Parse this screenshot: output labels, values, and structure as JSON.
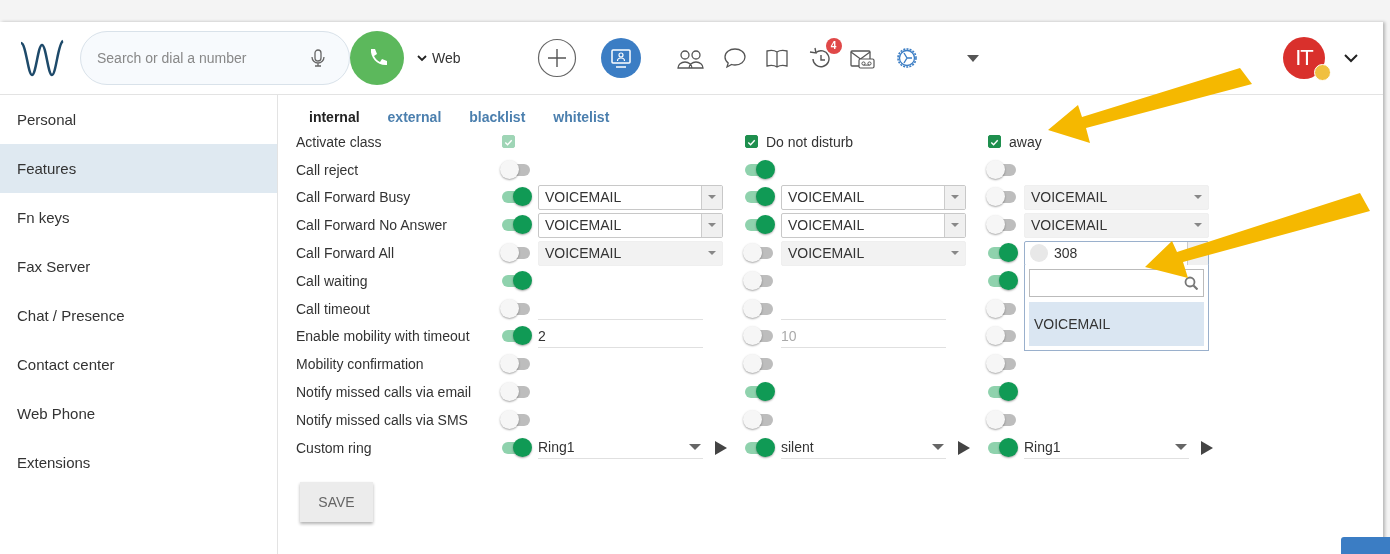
{
  "header": {
    "search": {
      "placeholder": "Search or dial a number"
    },
    "line_selector": "Web",
    "history_badge": "4",
    "avatar": {
      "initials": "IT"
    }
  },
  "sidebar": {
    "items": [
      {
        "label": "Personal",
        "selected": false
      },
      {
        "label": "Features",
        "selected": true
      },
      {
        "label": "Fn keys",
        "selected": false
      },
      {
        "label": "Fax Server",
        "selected": false
      },
      {
        "label": "Chat / Presence",
        "selected": false
      },
      {
        "label": "Contact center",
        "selected": false
      },
      {
        "label": "Web Phone",
        "selected": false
      },
      {
        "label": "Extensions",
        "selected": false
      }
    ]
  },
  "tabs": [
    {
      "label": "internal",
      "selected": true
    },
    {
      "label": "external",
      "selected": false
    },
    {
      "label": "blacklist",
      "selected": false
    },
    {
      "label": "whitelist",
      "selected": false
    }
  ],
  "rows": [
    {
      "label": "Activate class",
      "cells": [
        {
          "kind": "check",
          "checked": true,
          "disabled": true
        },
        {
          "kind": "check",
          "checked": true,
          "disabled": false,
          "label": "Do not disturb"
        },
        {
          "kind": "check",
          "checked": true,
          "disabled": false,
          "label": "away"
        }
      ]
    },
    {
      "label": "Call reject",
      "cells": [
        {
          "kind": "toggle",
          "on": false
        },
        {
          "kind": "toggle",
          "on": true
        },
        {
          "kind": "toggle",
          "on": false
        }
      ]
    },
    {
      "label": "Call Forward Busy",
      "cells": [
        {
          "kind": "toggle",
          "on": true,
          "field": {
            "kind": "select",
            "value": "VOICEMAIL",
            "disabled": false
          }
        },
        {
          "kind": "toggle",
          "on": true,
          "field": {
            "kind": "select",
            "value": "VOICEMAIL",
            "disabled": false
          }
        },
        {
          "kind": "toggle",
          "on": false,
          "field": {
            "kind": "select",
            "value": "VOICEMAIL",
            "disabled": true
          }
        }
      ]
    },
    {
      "label": "Call Forward No Answer",
      "cells": [
        {
          "kind": "toggle",
          "on": true,
          "field": {
            "kind": "select",
            "value": "VOICEMAIL",
            "disabled": false
          }
        },
        {
          "kind": "toggle",
          "on": true,
          "field": {
            "kind": "select",
            "value": "VOICEMAIL",
            "disabled": false
          }
        },
        {
          "kind": "toggle",
          "on": false,
          "field": {
            "kind": "select",
            "value": "VOICEMAIL",
            "disabled": true
          }
        }
      ]
    },
    {
      "label": "Call Forward All",
      "cells": [
        {
          "kind": "toggle",
          "on": false,
          "field": {
            "kind": "select",
            "value": "VOICEMAIL",
            "disabled": true
          }
        },
        {
          "kind": "toggle",
          "on": false,
          "field": {
            "kind": "select",
            "value": "VOICEMAIL",
            "disabled": true
          }
        },
        {
          "kind": "toggle",
          "on": true,
          "field": {
            "kind": "select",
            "value": "308",
            "disabled": false,
            "expanded": true,
            "options": [
              {
                "label": "VOICEMAIL",
                "selected": true
              }
            ]
          }
        }
      ]
    },
    {
      "label": "Call waiting",
      "cells": [
        {
          "kind": "toggle",
          "on": true
        },
        {
          "kind": "toggle",
          "on": false
        },
        {
          "kind": "toggle",
          "on": true
        }
      ]
    },
    {
      "label": "Call timeout",
      "cells": [
        {
          "kind": "toggle",
          "on": false,
          "field": {
            "kind": "input"
          }
        },
        {
          "kind": "toggle",
          "on": false,
          "field": {
            "kind": "input"
          }
        },
        {
          "kind": "toggle",
          "on": false
        }
      ]
    },
    {
      "label": "Enable mobility with timeout",
      "cells": [
        {
          "kind": "toggle",
          "on": true,
          "field": {
            "kind": "input",
            "value": "2",
            "disabled": false
          }
        },
        {
          "kind": "toggle",
          "on": false,
          "field": {
            "kind": "input",
            "value": "10",
            "disabled": true
          }
        },
        {
          "kind": "toggle",
          "on": false
        }
      ]
    },
    {
      "label": "Mobility confirmation",
      "cells": [
        {
          "kind": "toggle",
          "on": false
        },
        {
          "kind": "toggle",
          "on": false
        },
        {
          "kind": "toggle",
          "on": false
        }
      ]
    },
    {
      "label": "Notify missed calls via email",
      "cells": [
        {
          "kind": "toggle",
          "on": false
        },
        {
          "kind": "toggle",
          "on": true
        },
        {
          "kind": "toggle",
          "on": true
        }
      ]
    },
    {
      "label": "Notify missed calls via SMS",
      "cells": [
        {
          "kind": "toggle",
          "on": false
        },
        {
          "kind": "toggle",
          "on": false
        },
        {
          "kind": "toggle",
          "on": false
        }
      ]
    },
    {
      "label": "Custom ring",
      "cells": [
        {
          "kind": "toggle",
          "on": true,
          "field": {
            "kind": "ring",
            "value": "Ring1"
          }
        },
        {
          "kind": "toggle",
          "on": true,
          "field": {
            "kind": "ring",
            "value": "silent"
          }
        },
        {
          "kind": "toggle",
          "on": true,
          "field": {
            "kind": "ring",
            "value": "Ring1"
          }
        }
      ]
    }
  ],
  "save_button": "SAVE"
}
